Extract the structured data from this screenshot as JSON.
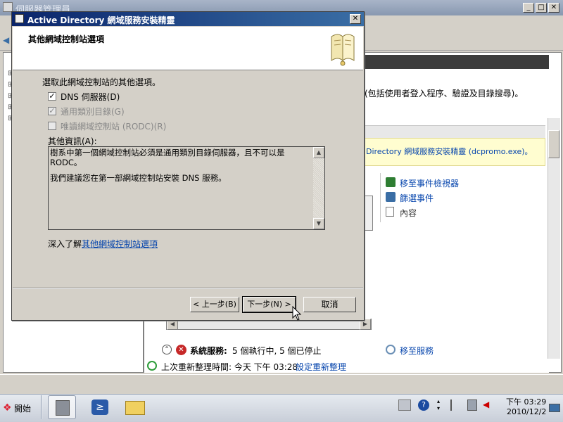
{
  "server_manager": {
    "title": "伺服器管理員",
    "role_desc": "(包括使用者登入程序、驗證及目錄搜尋)。",
    "notice": "Directory 網域服務安裝精靈  (dcpromo.exe)。",
    "actions": [
      "移至事件檢視器",
      "篩選事件",
      "內容"
    ],
    "system_services_label": "系統服務:",
    "system_services_status": "5 個執行中, 5 個已停止",
    "goto_services": "移至服務",
    "refresh_text": "上次重新整理時間: 今天 下午 03:28",
    "refresh_link": "設定重新整理"
  },
  "dialog": {
    "title": "Active Directory 網域服務安裝精靈",
    "heading": "其他網域控制站選項",
    "prompt": "選取此網域控制站的其他選項。",
    "options": [
      {
        "label": "DNS 伺服器(D)",
        "checked": true,
        "enabled": true
      },
      {
        "label": "通用類別目錄(G)",
        "checked": true,
        "enabled": false
      },
      {
        "label": "唯讀網域控制站 (RODC)(R)",
        "checked": false,
        "enabled": false
      }
    ],
    "info_label": "其他資訊(A):",
    "info_line1": "樹系中第一個網域控制站必須是通用類別目錄伺服器，且不可以是",
    "info_line2": "RODC。",
    "info_line3": "我們建議您在第一部網域控制站安裝 DNS 服務。",
    "learn_prefix": "深入了解",
    "learn_link": "其他網域控制站選項",
    "back_button": "< 上一步(B)",
    "next_button": "下一步(N) >",
    "cancel_button": "取消"
  },
  "taskbar": {
    "start_label": "開始",
    "time": "下午 03:29",
    "date": "2010/12/2"
  }
}
